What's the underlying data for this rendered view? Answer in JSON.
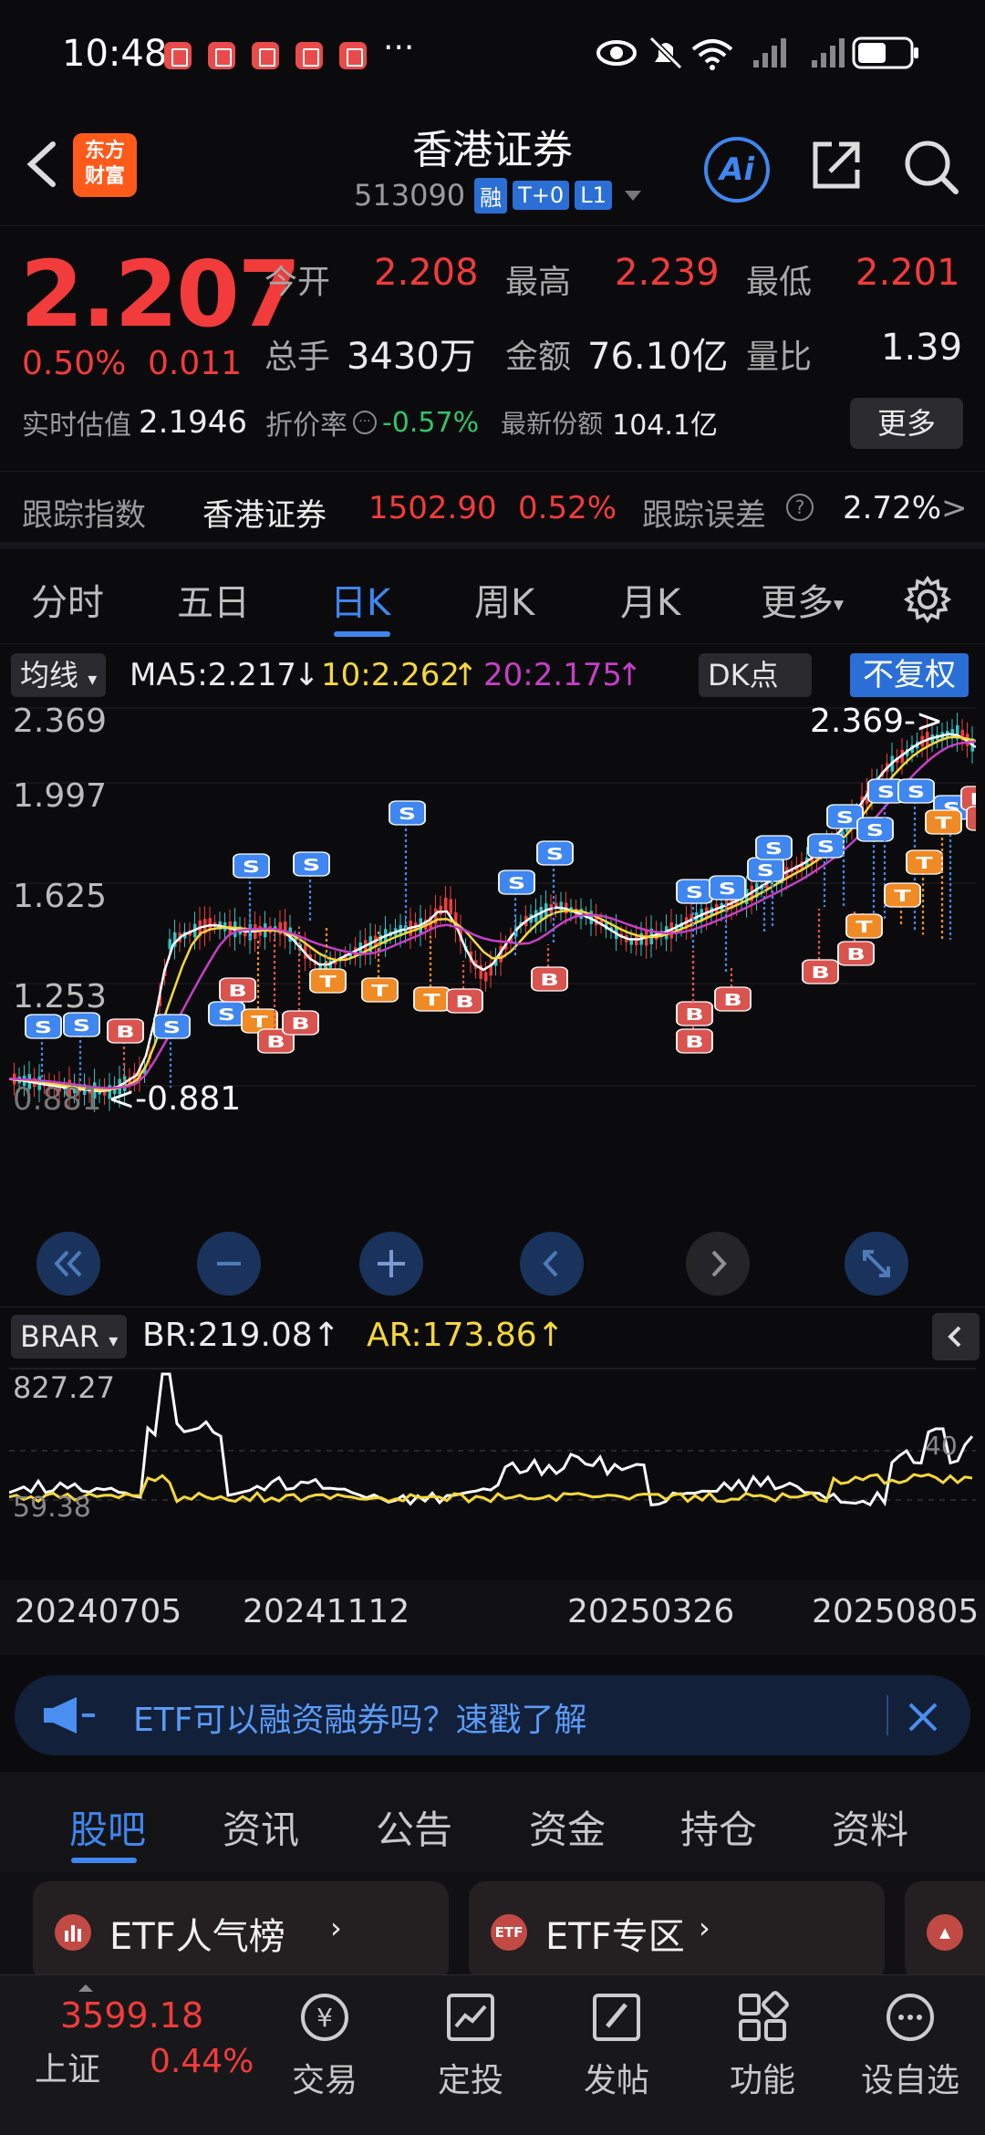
{
  "status": {
    "time": "10:48",
    "dots": "···"
  },
  "header": {
    "title": "香港证券",
    "code": "513090",
    "tags": [
      "融",
      "T+0",
      "L1"
    ],
    "logo": "东方\n财富",
    "ai_label": "Ai"
  },
  "quote": {
    "price": "2.207",
    "change_pct": "0.50%",
    "change_amt": "0.011",
    "open_label": "今开",
    "open": "2.208",
    "high_label": "最高",
    "high": "2.239",
    "low_label": "最低",
    "low": "2.201",
    "vol_label": "总手",
    "vol": "3430万",
    "amount_label": "金额",
    "amount": "76.10亿",
    "ratio_label": "量比",
    "ratio": "1.39",
    "est_label": "实时估值",
    "est": "2.1946",
    "discount_label": "折价率",
    "discount": "-0.57%",
    "shares_label": "最新份额",
    "shares": "104.1亿",
    "more": "更多"
  },
  "tracking": {
    "label": "跟踪指数",
    "index_name": "香港证券",
    "index_value": "1502.90",
    "index_pct": "0.52%",
    "error_label": "跟踪误差",
    "error": "2.72%"
  },
  "tabs": [
    "分时",
    "五日",
    "日K",
    "周K",
    "月K",
    "更多"
  ],
  "ma": {
    "selector": "均线",
    "ma5": "MA5:2.217",
    "ma10": "10:2.262",
    "ma20": "20:2.175",
    "dk": "DK点",
    "fq": "不复权"
  },
  "kchart": {
    "y_labels": [
      "2.369",
      "1.997",
      "1.625",
      "1.253",
      "0.881"
    ],
    "max_note": "2.369->",
    "min_note": "<-0.881",
    "colors": {
      "up": "#f23b3b",
      "down": "#2ec4c4",
      "ma5": "#ffffff",
      "ma10": "#f5d83a",
      "ma20": "#c63fc6",
      "buy": "#d9534f",
      "sell": "#3f86f0",
      "t": "#f08a24"
    }
  },
  "brar": {
    "selector": "BRAR",
    "br": "BR:219.08",
    "ar": "AR:173.86",
    "top": "827.27",
    "bottom": "59.38",
    "right_mark": "40"
  },
  "dates": [
    "20240705",
    "20241112",
    "20250326",
    "20250805"
  ],
  "banner": {
    "text": "ETF可以融资融券吗？速戳了解"
  },
  "sections": [
    "股吧",
    "资讯",
    "公告",
    "资金",
    "持仓",
    "资料"
  ],
  "cards": [
    {
      "label": "ETF人气榜",
      "icon": ""
    },
    {
      "label": "ETF专区",
      "icon": "ETF"
    }
  ],
  "nav": {
    "index_value": "3599.18",
    "index_name": "上证",
    "index_pct": "0.44%",
    "items": [
      "交易",
      "定投",
      "发帖",
      "功能",
      "设自选"
    ]
  }
}
